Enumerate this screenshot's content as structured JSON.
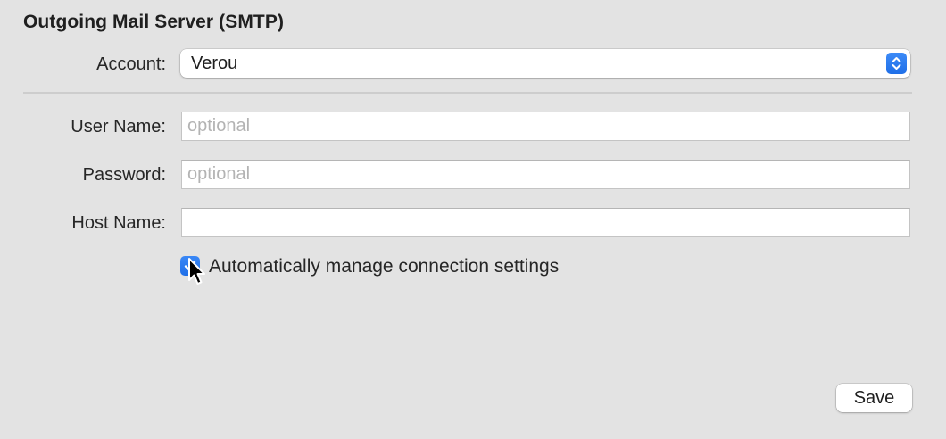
{
  "section": {
    "title": "Outgoing Mail Server (SMTP)"
  },
  "account": {
    "label": "Account:",
    "value": "Verou"
  },
  "user_name": {
    "label": "User Name:",
    "placeholder": "optional",
    "value": ""
  },
  "password": {
    "label": "Password:",
    "placeholder": "optional",
    "value": ""
  },
  "host_name": {
    "label": "Host Name:",
    "placeholder": "",
    "value": ""
  },
  "auto_manage": {
    "label": "Automatically manage connection settings",
    "checked": true
  },
  "actions": {
    "save_label": "Save"
  },
  "icons": {
    "popup_stepper": "chevron-up-down-icon",
    "checkbox_mark": "checkmark-icon",
    "cursor": "mouse-pointer-icon"
  },
  "colors": {
    "accent": "#1f6fe8",
    "background": "#e3e3e3",
    "placeholder": "#b3b3b3"
  }
}
